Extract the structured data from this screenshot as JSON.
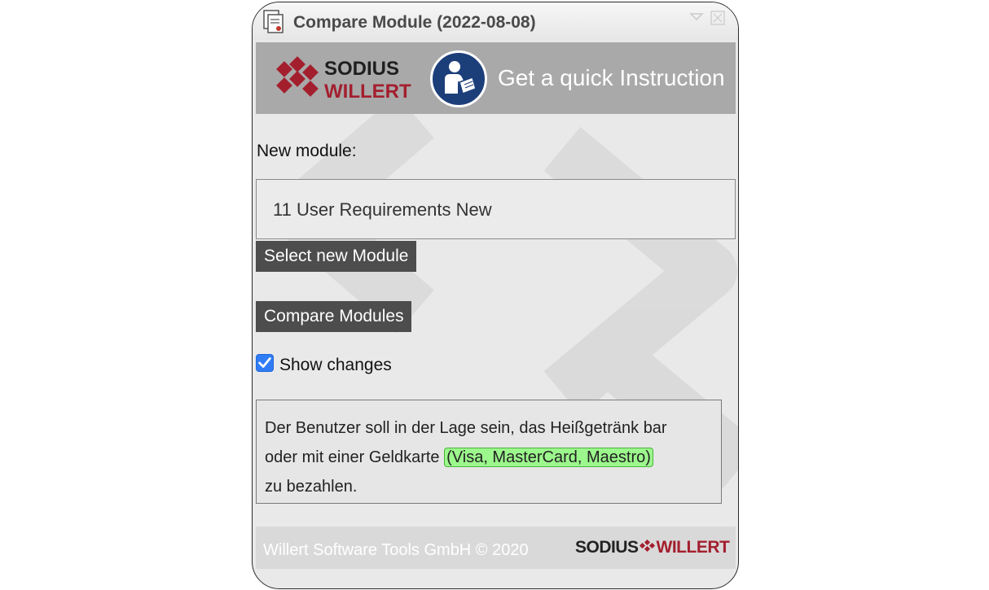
{
  "window": {
    "title": "Compare Module (2022-08-08)"
  },
  "banner": {
    "logo_line1": "SODIUS",
    "logo_line2": "WILLERT",
    "instruction_label": "Get a quick Instruction"
  },
  "form": {
    "new_module_label": "New module:",
    "new_module_value": "11 User Requirements New",
    "select_button": "Select new Module",
    "compare_button": "Compare Modules",
    "show_changes_label": "Show changes",
    "show_changes_checked": true
  },
  "diff": {
    "line1": "Der Benutzer soll in der Lage sein, das Heißgetränk bar",
    "line2_prefix": "oder mit einer Geldkarte ",
    "line2_highlight": "(Visa, MasterCard, Maestro)",
    "line3": "zu bezahlen."
  },
  "footer": {
    "copyright": "Willert Software Tools GmbH © 2020",
    "logo_left": "SODIUS",
    "logo_right": "WILLERT"
  },
  "colors": {
    "banner_bg": "#a9a9a9",
    "button_bg": "#4d4d4d",
    "brand_red": "#a31f2e",
    "instruction_icon_bg": "#1c3f7a",
    "highlight_bg": "#9cf78c",
    "checkbox": "#2f7cf6"
  },
  "icons": [
    "document-app-icon",
    "minimize-icon",
    "close-icon",
    "sodius-willert-logo",
    "read-instruction-icon",
    "checkbox-checked-icon"
  ]
}
